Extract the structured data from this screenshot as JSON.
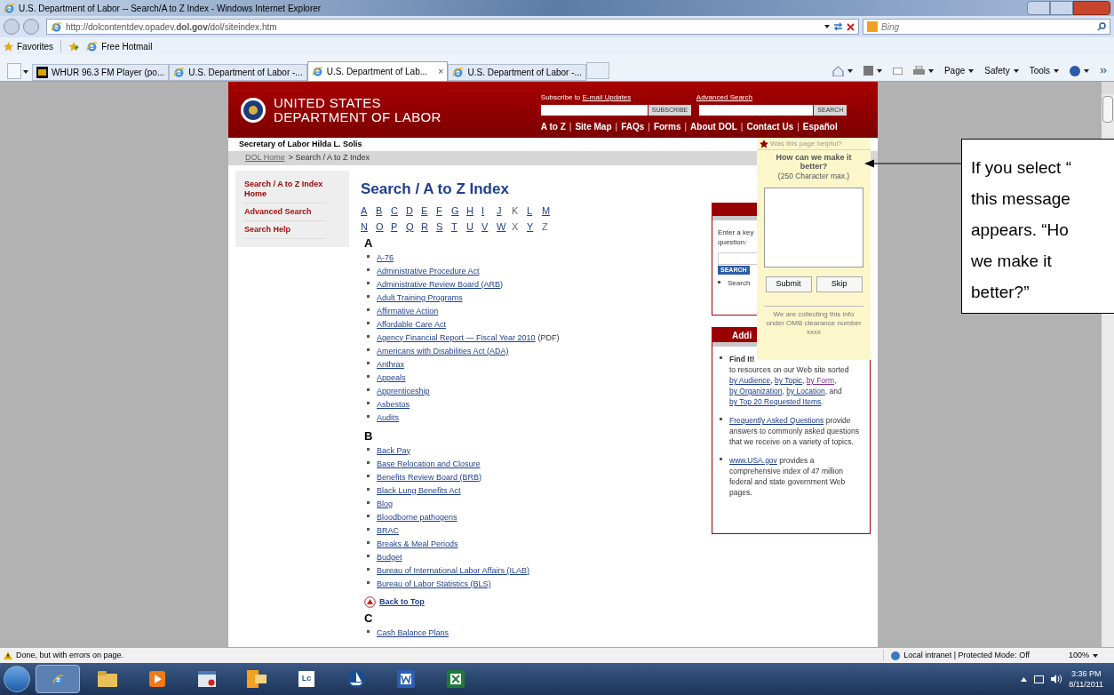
{
  "browser": {
    "title": "U.S. Department of Labor -- Search/A to Z Index - Windows Internet Explorer",
    "address": "http://dolcontentdev.opadev.**dol.gov**/dol/siteindex.htm",
    "search_placeholder": "Bing",
    "favorites": [
      "Favorites",
      "Free Hotmail"
    ],
    "tabs": [
      {
        "label": "WHUR 96.3 FM Player (po...",
        "selected": false,
        "kind": "radio"
      },
      {
        "label": "U.S. Department of Labor -...",
        "selected": false,
        "kind": "ie"
      },
      {
        "label": "U.S. Department of Lab...",
        "selected": true,
        "kind": "ie"
      },
      {
        "label": "U.S. Department of Labor -...",
        "selected": false,
        "kind": "ie"
      }
    ],
    "close_tab": "×",
    "commands": [
      "Page",
      "Safety",
      "Tools"
    ]
  },
  "page": {
    "agency_lines": [
      "UNITED STATES",
      "DEPARTMENT OF LABOR"
    ],
    "subscribe_prefix": "Subscribe to",
    "subscribe_link": "E-mail Updates",
    "subscribe_button": "SUBSCRIBE",
    "advanced_search": "Advanced Search",
    "search_button": "SEARCH",
    "nav": [
      {
        "kind": "link",
        "text": "A to Z"
      },
      {
        "kind": "sep",
        "text": "|"
      },
      {
        "kind": "link",
        "text": "Site Map"
      },
      {
        "kind": "sep",
        "text": "|"
      },
      {
        "kind": "link",
        "text": "FAQs"
      },
      {
        "kind": "sep",
        "text": "|"
      },
      {
        "kind": "link",
        "text": "Forms"
      },
      {
        "kind": "sep",
        "text": "|"
      },
      {
        "kind": "link",
        "text": "About DOL"
      },
      {
        "kind": "sep",
        "text": "|"
      },
      {
        "kind": "link",
        "text": "Contact Us"
      },
      {
        "kind": "sep",
        "text": "|"
      },
      {
        "kind": "link",
        "text": "Español"
      }
    ],
    "secretary": "Secretary of Labor Hilda L. Solis",
    "breadcrumb": {
      "home": "DOL Home",
      "current": "> Search / A to Z Index"
    },
    "sidebar": [
      {
        "label": "Search / A to Z Index Home",
        "selected": true
      },
      {
        "label": "Advanced Search",
        "selected": false
      },
      {
        "label": "Search Help",
        "selected": false
      }
    ],
    "title": "Search / A to Z Index",
    "letter_rows": [
      [
        {
          "text": "A",
          "link": true
        },
        {
          "text": "B",
          "link": true
        },
        {
          "text": "C",
          "link": true
        },
        {
          "text": "D",
          "link": true
        },
        {
          "text": "E",
          "link": true
        },
        {
          "text": "F",
          "link": true
        },
        {
          "text": "G",
          "link": true
        },
        {
          "text": "H",
          "link": true
        },
        {
          "text": "I",
          "link": true
        },
        {
          "text": "J",
          "link": true
        },
        {
          "text": "K",
          "link": false
        },
        {
          "text": "L",
          "link": true
        },
        {
          "text": "M",
          "link": true
        }
      ],
      [
        {
          "text": "N",
          "link": true
        },
        {
          "text": "O",
          "link": true
        },
        {
          "text": "P",
          "link": true
        },
        {
          "text": "Q",
          "link": true
        },
        {
          "text": "R",
          "link": true
        },
        {
          "text": "S",
          "link": true
        },
        {
          "text": "T",
          "link": true
        },
        {
          "text": "U",
          "link": true
        },
        {
          "text": "V",
          "link": true
        },
        {
          "text": "W",
          "link": true
        },
        {
          "text": "X",
          "link": false
        },
        {
          "text": "Y",
          "link": true
        },
        {
          "text": "Z",
          "link": false
        }
      ]
    ],
    "sections": [
      {
        "heading": "A",
        "items": [
          {
            "text": "A-76"
          },
          {
            "text": "Administrative Procedure Act"
          },
          {
            "text": "Administrative Review Board (ARB)"
          },
          {
            "text": "Adult Training Programs"
          },
          {
            "text": "Affirmative Action"
          },
          {
            "text": "Affordable Care Act"
          },
          {
            "text": "Agency Financial Report — Fiscal Year 2010",
            "note": "(PDF)"
          },
          {
            "text": "Americans with Disabilities Act (ADA)"
          },
          {
            "text": "Anthrax"
          },
          {
            "text": "Appeals"
          },
          {
            "text": "Apprenticeship"
          },
          {
            "text": "Asbestos"
          },
          {
            "text": "Audits"
          }
        ]
      },
      {
        "heading": "B",
        "items": [
          {
            "text": "Back Pay"
          },
          {
            "text": "Base Relocation and Closure"
          },
          {
            "text": "Benefits Review Board (BRB)"
          },
          {
            "text": "Black Lung Benefits Act"
          },
          {
            "text": "Blog"
          },
          {
            "text": "Bloodborne pathogens"
          },
          {
            "text": "BRAC"
          },
          {
            "text": "Breaks & Meal Periods"
          },
          {
            "text": "Budget"
          },
          {
            "text": "Bureau of International Labor Affairs (ILAB)"
          },
          {
            "text": "Bureau of Labor Statistics (BLS)"
          }
        ],
        "back_to_top": "Back to Top"
      },
      {
        "heading": "C",
        "items": [
          {
            "text": "Cash Balance Plans"
          }
        ]
      }
    ],
    "search_box": {
      "prompt_lines": [
        "Enter a key",
        "question:"
      ],
      "button": "SEARCH",
      "bullet": "Search"
    },
    "resources_box": {
      "heading": "Addi",
      "items": [
        [
          {
            "kind": "bold",
            "text": "Find It!"
          },
          {
            "kind": "break"
          },
          {
            "kind": "plain",
            "text": "to resources on our Web site sorted "
          },
          {
            "kind": "link",
            "text": "by Audience"
          },
          {
            "kind": "plain",
            "text": ", "
          },
          {
            "kind": "link",
            "text": "by Topic"
          },
          {
            "kind": "plain",
            "text": ", "
          },
          {
            "kind": "visited",
            "text": "by Form"
          },
          {
            "kind": "plain",
            "text": ", "
          },
          {
            "kind": "link",
            "text": "by Organization"
          },
          {
            "kind": "plain",
            "text": ", "
          },
          {
            "kind": "link",
            "text": "by Location"
          },
          {
            "kind": "plain",
            "text": ", and "
          },
          {
            "kind": "link",
            "text": "by Top 20 Requested Items"
          },
          {
            "kind": "plain",
            "text": "."
          }
        ],
        [
          {
            "kind": "link",
            "text": "Frequently Asked Questions"
          },
          {
            "kind": "plain",
            "text": " provide answers to commonly asked questions that we receive on a variety of topics."
          }
        ],
        [
          {
            "kind": "link",
            "text": "www.USA.gov"
          },
          {
            "kind": "plain",
            "text": " provides a comprehensive index of 47 million federal and state government Web pages."
          }
        ]
      ]
    },
    "feedback": {
      "faded_title": "Was this page helpful?",
      "question": "How can we make it better?",
      "limit": "(250 Character max.)",
      "buttons": [
        "Submit",
        "Skip"
      ],
      "footer": "We are collecting this info under OMB clearance number xxxx"
    }
  },
  "callout": {
    "lines": [
      "If you select “",
      "this message",
      "appears. “Ho",
      "we make it",
      "better?”"
    ]
  },
  "status_bar": {
    "text": "Done, but with errors on page.",
    "zone": "Local intranet | Protected Mode: Off",
    "zoom": "100%"
  },
  "taskbar": {
    "apps": [
      {
        "kind": "ie",
        "selected": true
      },
      {
        "kind": "folder",
        "selected": false
      },
      {
        "kind": "media",
        "selected": false
      },
      {
        "kind": "window",
        "selected": false
      },
      {
        "kind": "outlook",
        "selected": false
      },
      {
        "kind": "lc",
        "label": "Lc",
        "selected": false
      },
      {
        "kind": "sail",
        "selected": false
      },
      {
        "kind": "word",
        "selected": false
      },
      {
        "kind": "excel",
        "selected": false
      }
    ],
    "time": "3:36 PM",
    "date": "8/11/2011"
  }
}
